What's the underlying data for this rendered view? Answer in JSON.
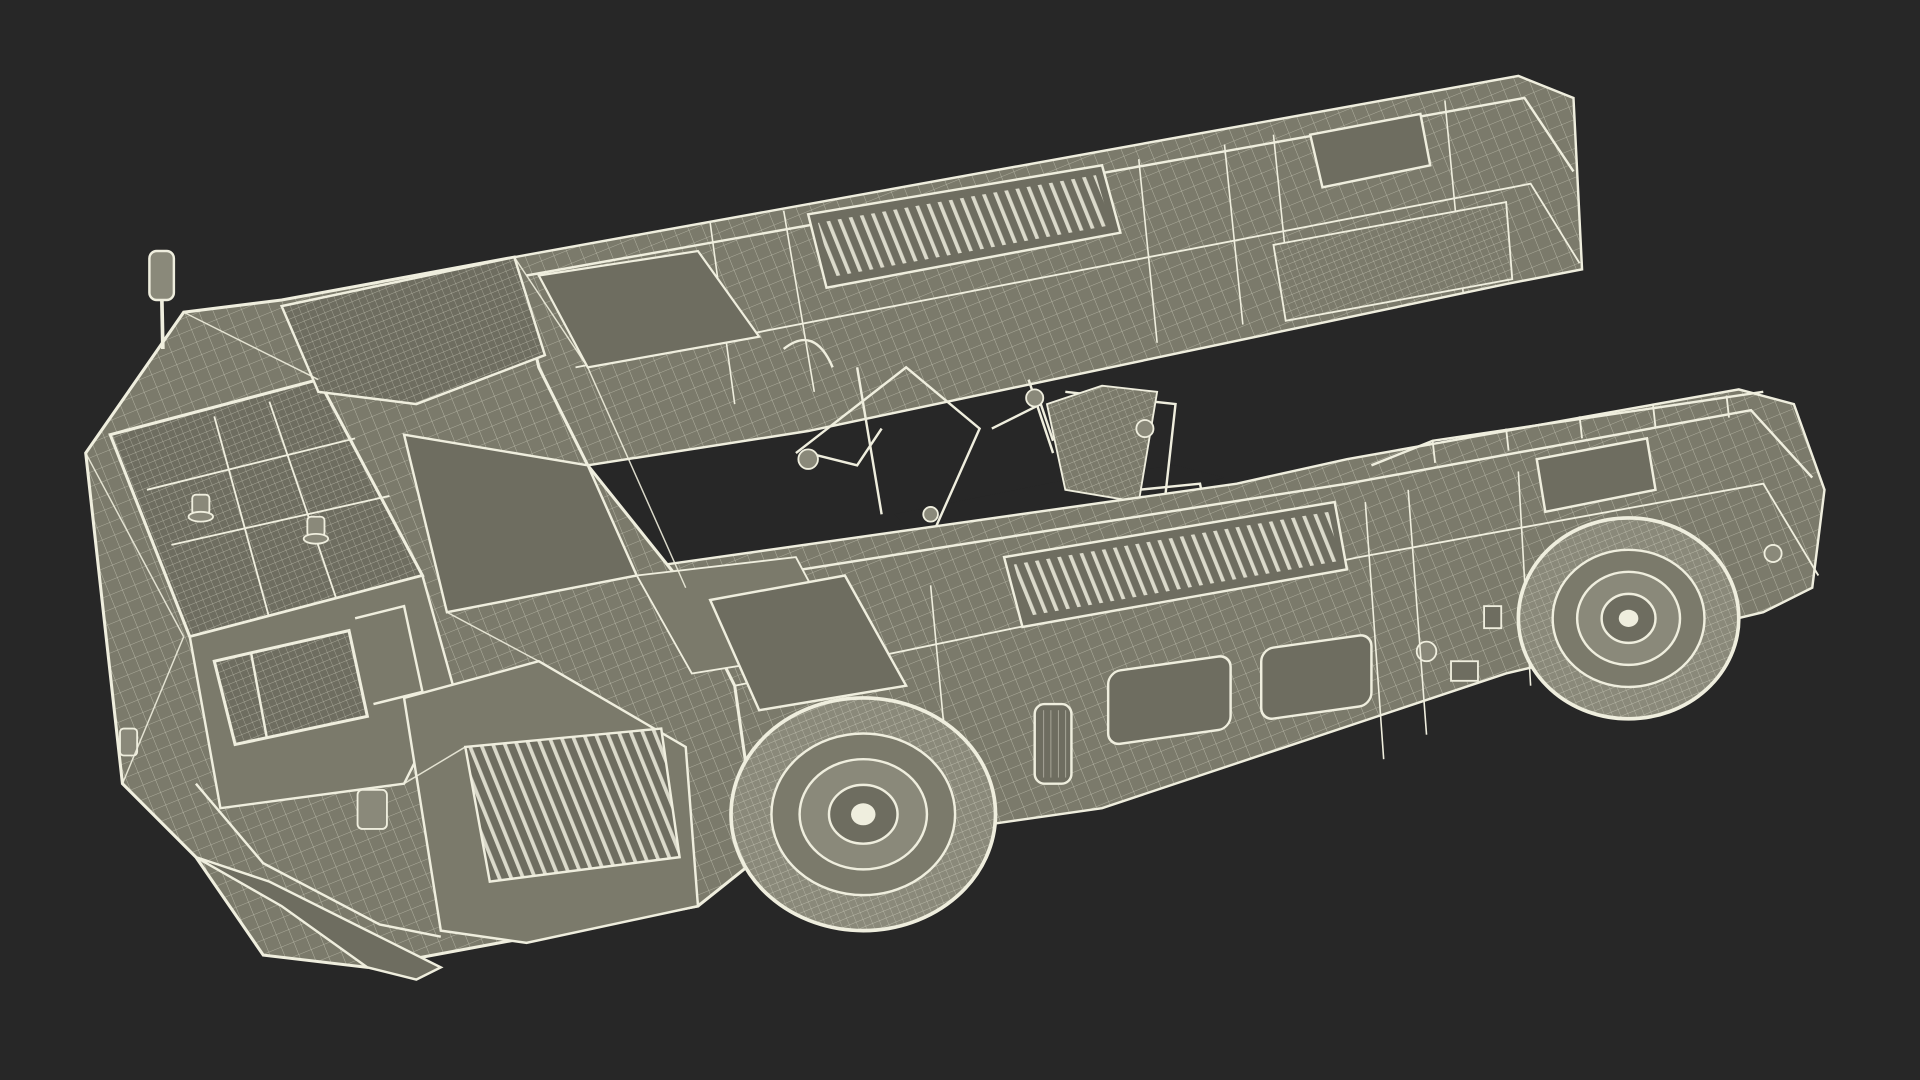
{
  "scene": {
    "subject": "wireframe-render-aircraft-tug",
    "colors": {
      "background": "#272727",
      "body_fill": "#7b7a6b",
      "body_fill_dark": "#6e6d60",
      "wire": "#efeede",
      "wire_dim": "#d8d7c4",
      "tire_fill": "#8a897a",
      "void": "#272727"
    }
  }
}
